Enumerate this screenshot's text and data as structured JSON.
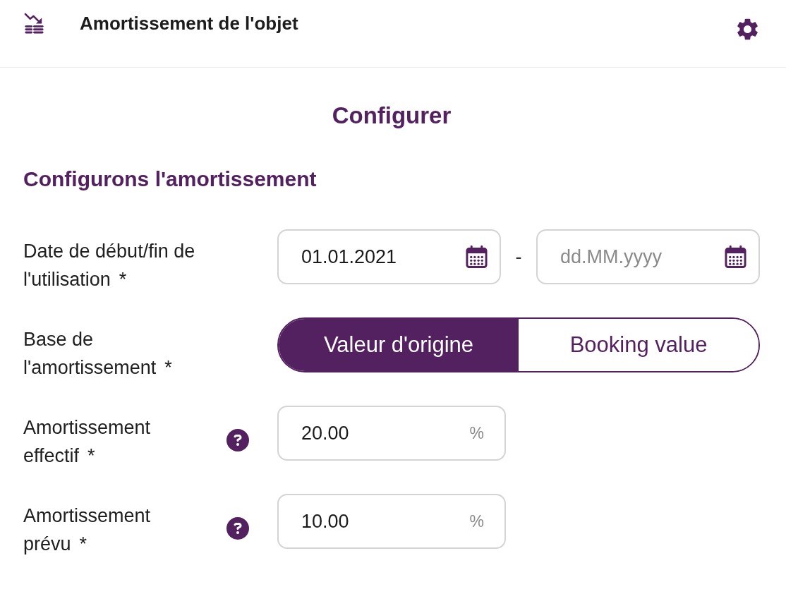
{
  "header": {
    "title": "Amortissement de l'objet"
  },
  "page_title": "Configurer",
  "section_title": "Configurons l'amortissement",
  "fields": [
    {
      "kind": "date_range",
      "label": "Date de début/fin de l'utilisation",
      "required_mark": "*",
      "start": {
        "value": "01.01.2021"
      },
      "separator": "-",
      "end": {
        "placeholder": "dd.MM.yyyy"
      }
    },
    {
      "kind": "toggle",
      "label": "Base de l'amortissement",
      "required_mark": "*",
      "options": [
        {
          "label": "Valeur d'origine",
          "selected": true
        },
        {
          "label": "Booking value",
          "selected": false
        }
      ]
    },
    {
      "kind": "percent",
      "label": "Amortissement effectif",
      "required_mark": "*",
      "help": true,
      "value": "20.00",
      "unit": "%"
    },
    {
      "kind": "percent",
      "label": "Amortissement prévu",
      "required_mark": "*",
      "help": true,
      "value": "10.00",
      "unit": "%"
    }
  ]
}
